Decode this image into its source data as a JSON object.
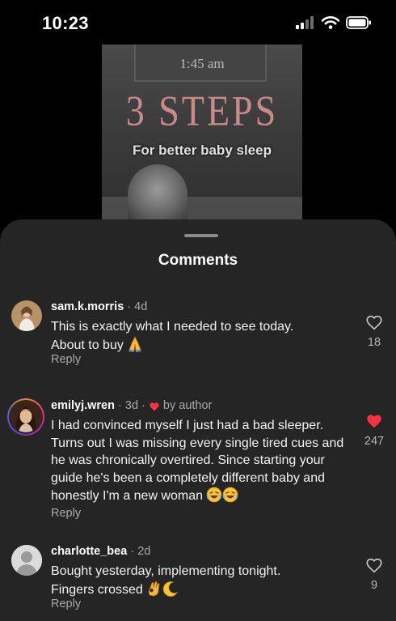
{
  "status_bar": {
    "time": "10:23"
  },
  "video": {
    "overlay_time": "1:45 am",
    "headline": "3 STEPS",
    "subtitle": "For better baby sleep"
  },
  "sheet": {
    "title": "Comments"
  },
  "comments": [
    {
      "username": "sam.k.morris",
      "age": "4d",
      "text": "This is exactly what I needed to see today. About to buy",
      "reply_label": "Reply",
      "likes": "18",
      "liked": false
    },
    {
      "username": "emilyj.wren",
      "age": "3d",
      "author_badge": "by author",
      "text": "I had convinced myself I just had a bad sleeper. Turns out I was missing every single tired cues and he was chronically overtired. Since starting your guide he's been a completely different baby and honestly I'm a new woman",
      "reply_label": "Reply",
      "likes": "247",
      "liked": true
    },
    {
      "username": "charlotte_bea",
      "age": "2d",
      "text": "Bought yesterday, implementing tonight. Fingers crossed",
      "reply_label": "Reply",
      "likes": "9",
      "liked": false
    }
  ],
  "colors": {
    "sheet_bg": "#252525",
    "like_red": "#ff3040",
    "muted_text": "#a8a8a8"
  },
  "icons": [
    "cellular-signal-icon",
    "wifi-icon",
    "battery-icon",
    "heart-outline-icon",
    "heart-filled-icon",
    "default-avatar-icon",
    "praying-hands-emoji",
    "laughing-emoji",
    "ok-hand-emoji",
    "crescent-moon-emoji"
  ]
}
